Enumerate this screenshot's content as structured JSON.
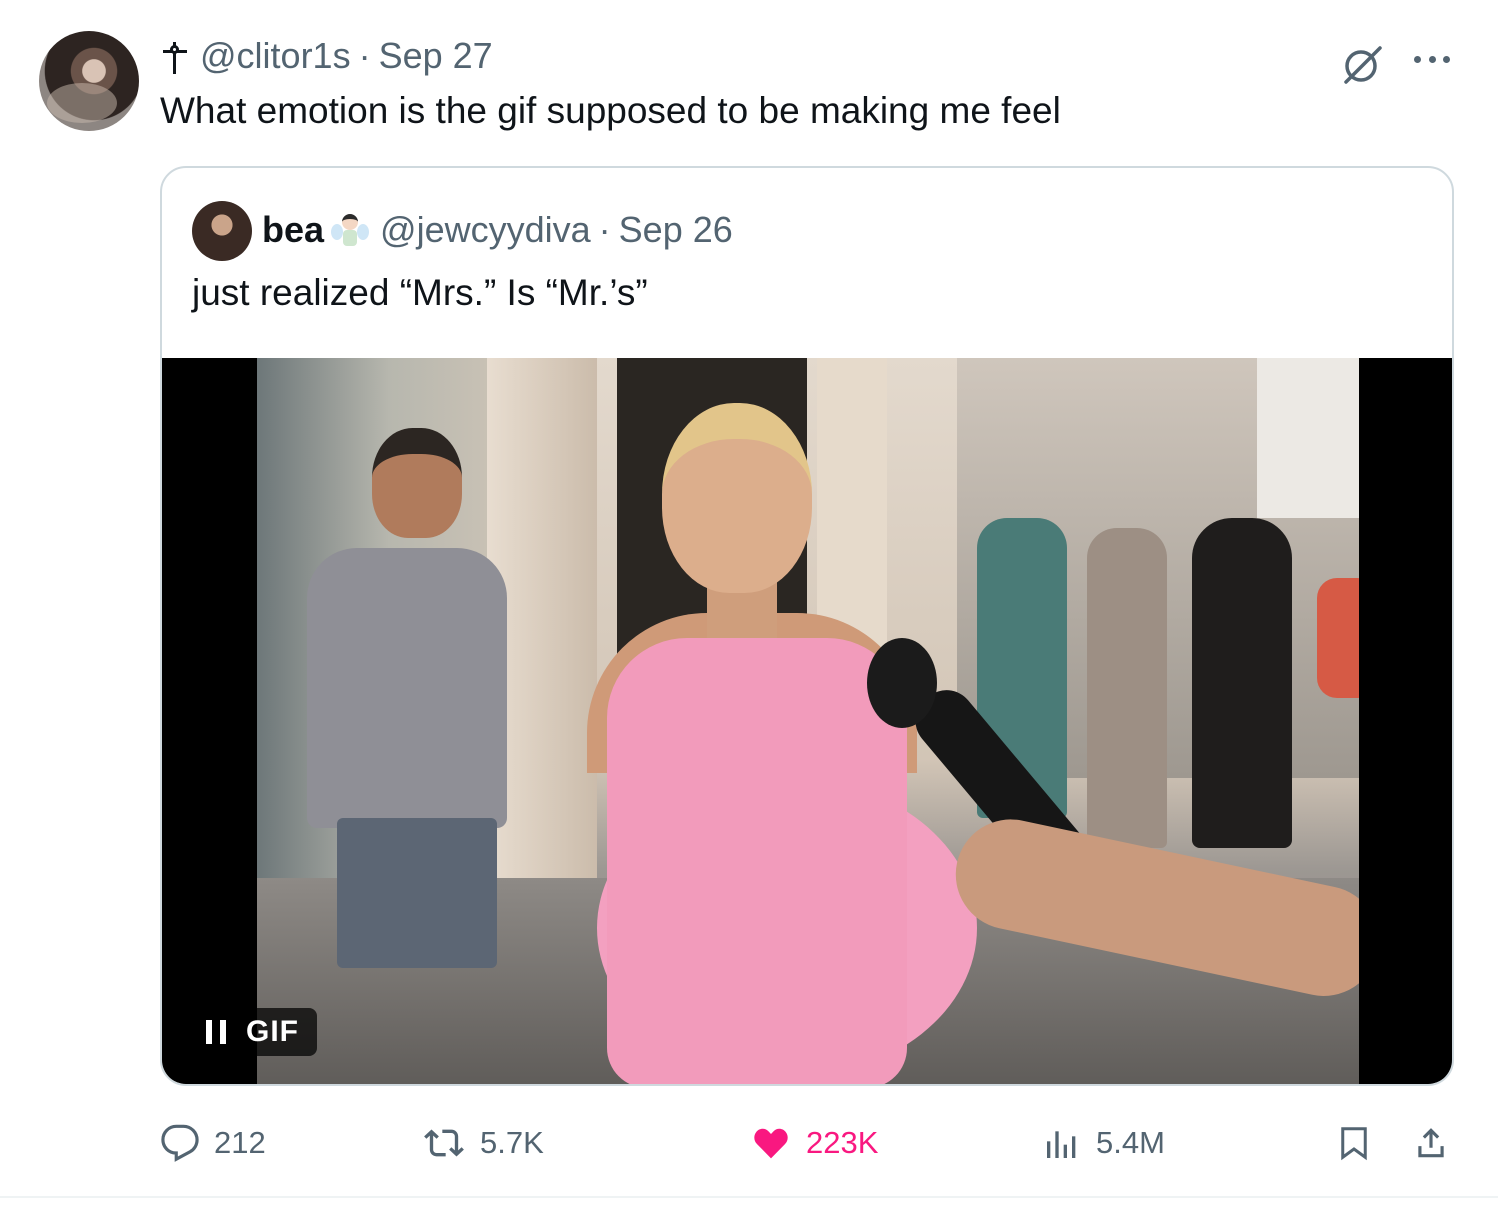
{
  "tweet": {
    "author_handle": "@clitor1s",
    "separator": "·",
    "date": "Sep 27",
    "text": "What emotion is the gif supposed to be making me feel"
  },
  "quoted_tweet": {
    "display_name": "bea",
    "handle": "@jewcyydiva",
    "separator": "·",
    "date": "Sep 26",
    "text": "just realized “Mrs.” Is “Mr.’s”",
    "media": {
      "badge_label": "GIF",
      "state_icon": "pause-icon"
    }
  },
  "actions": {
    "replies": "212",
    "reposts": "5.7K",
    "likes": "223K",
    "views": "5.4M"
  },
  "icons": {
    "header": [
      "cross-icon",
      "grok-icon",
      "more-icon"
    ],
    "actions": [
      "reply-icon",
      "repost-icon",
      "heart-icon",
      "views-icon",
      "bookmark-icon",
      "share-icon"
    ]
  },
  "colors": {
    "text_primary": "#0f1419",
    "text_secondary": "#536471",
    "like_active": "#f91880",
    "border": "#cfd9de"
  }
}
